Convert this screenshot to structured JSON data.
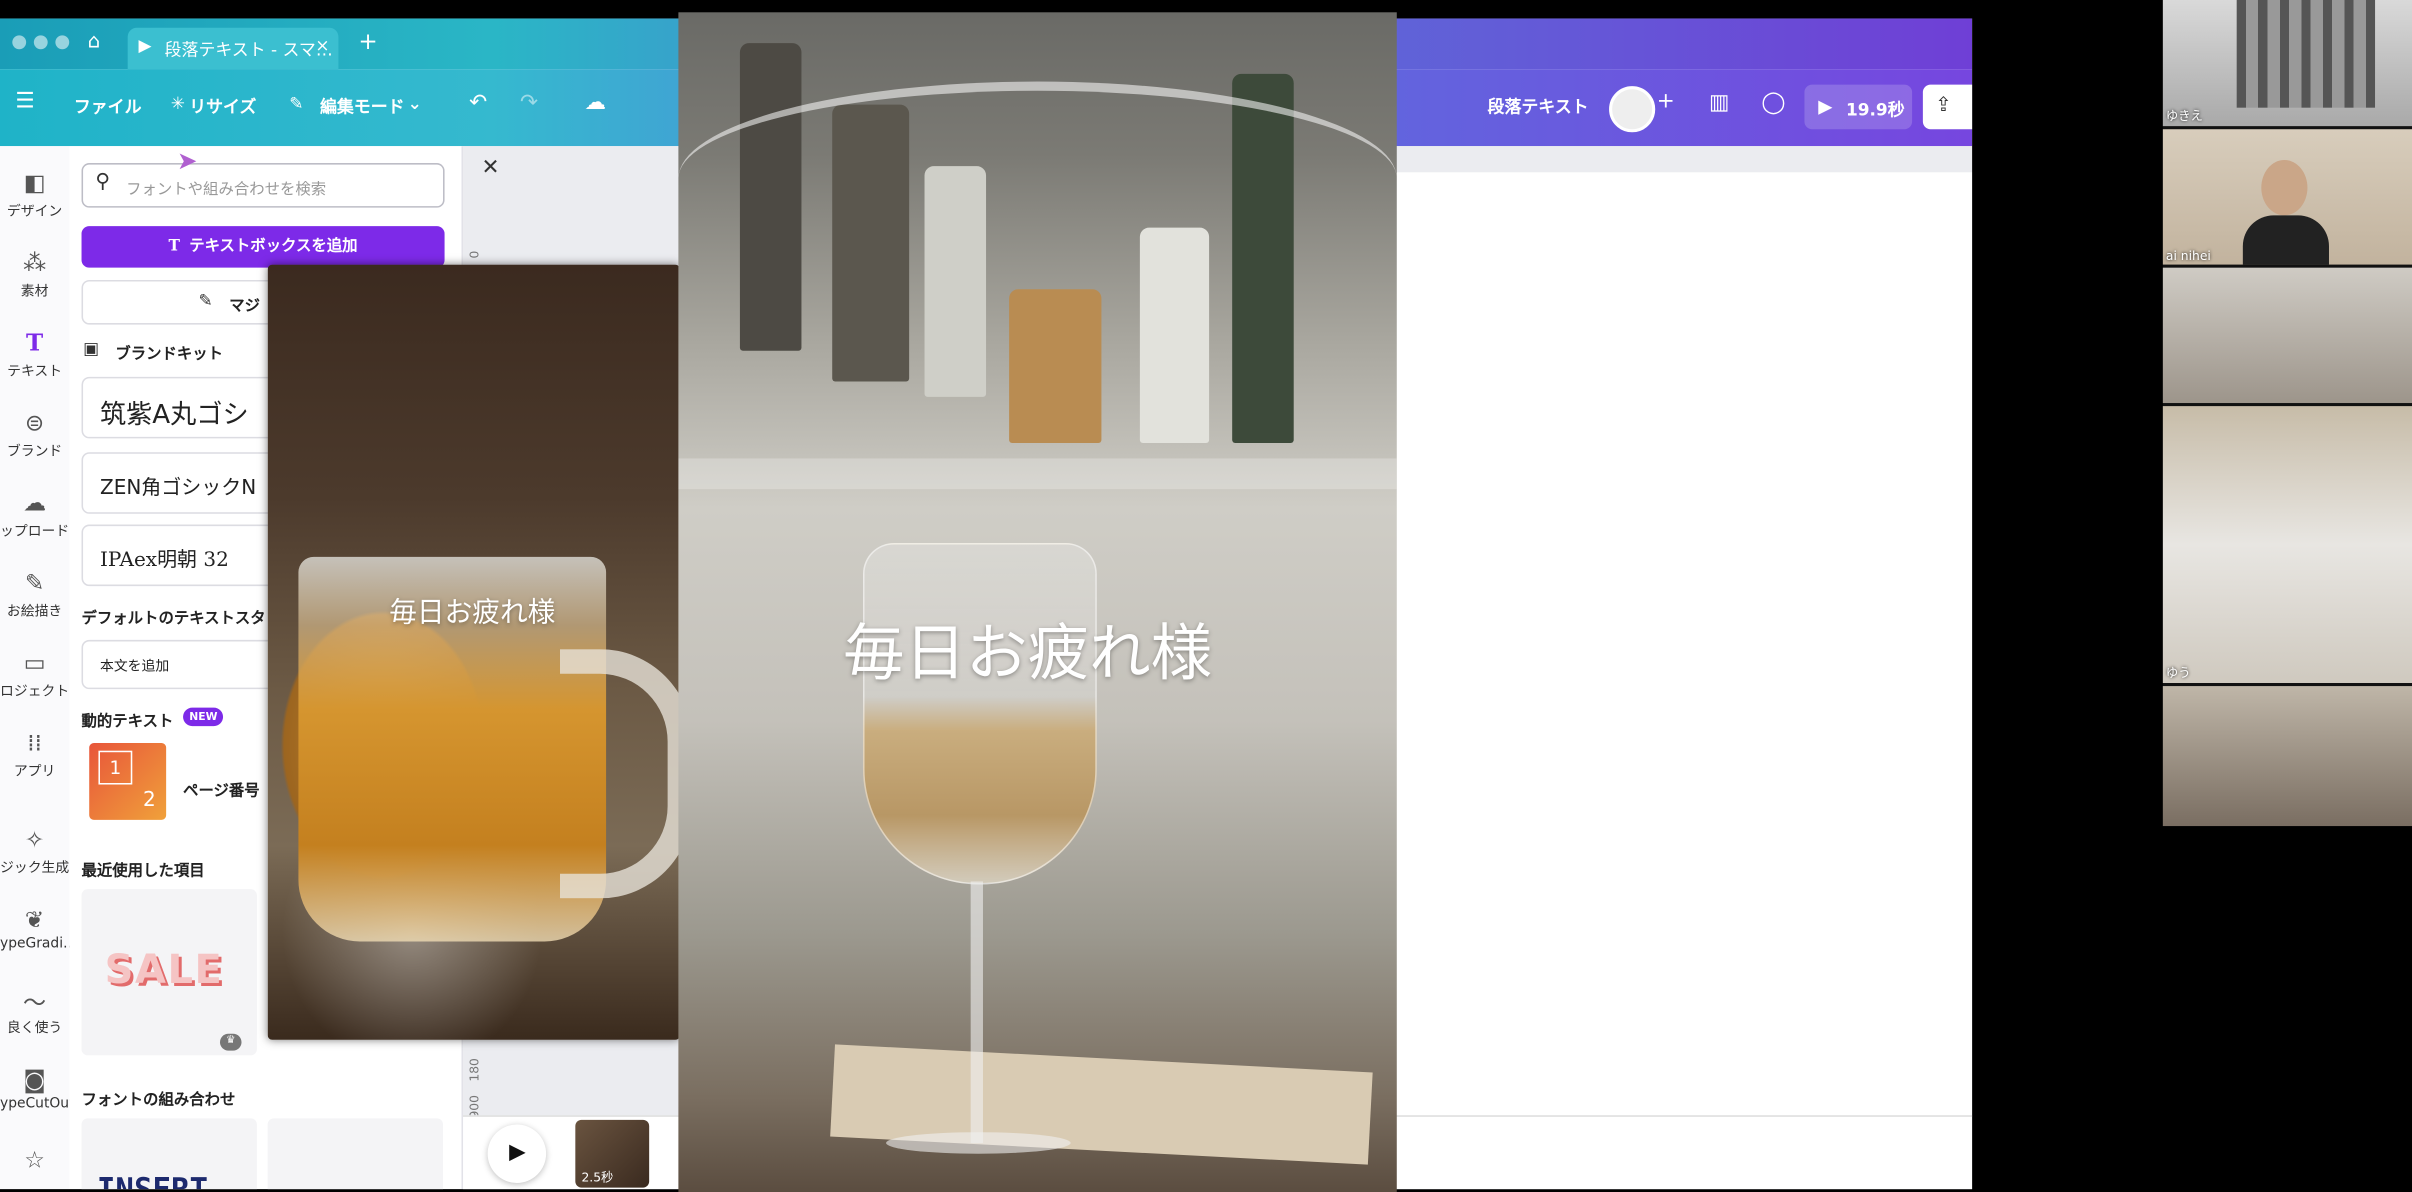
{
  "tabbar": {
    "tab_title": "段落テキスト - スマ…",
    "close_glyph": "×",
    "new_tab_glyph": "+"
  },
  "toolbar": {
    "file": "ファイル",
    "resize": "リサイズ",
    "edit_mode": "編集モード",
    "doc_title": "段落テキスト",
    "play_time": "19.9秒"
  },
  "rail": {
    "items": [
      "デザイン",
      "素材",
      "テキスト",
      "ブランド",
      "ップロード",
      "お絵描き",
      "ロジェクト",
      "アプリ",
      "ジック生成",
      "ypeGradi…",
      "良く使う",
      "ypeCutOut"
    ]
  },
  "panel": {
    "search_placeholder": "フォントや組み合わせを検索",
    "add_textbox": "テキストボックスを追加",
    "magic": "マジ",
    "brand_kit": "ブランドキット",
    "fonts": [
      "筑紫A丸ゴシ",
      "ZEN角ゴシックN",
      "IPAex明朝 32"
    ],
    "default_styles": "デフォルトのテキストスタ",
    "add_body": "本文を追加",
    "dynamic_text": "動的テキスト",
    "new_badge": "NEW",
    "page_number": "ページ番号",
    "page_thumb_1": "1",
    "page_thumb_2": "2",
    "recent": "最近使用した項目",
    "sale": "SALE",
    "font_combos": "フォントの組み合わせ",
    "insert": "INSERT"
  },
  "canvas": {
    "ruler_0": "0",
    "ruler_180": "180",
    "ruler_900": "900",
    "clip_duration": "2.5秒"
  },
  "overlay": {
    "mug_text": "毎日お疲れ様",
    "wine_text": "毎日お疲れ様"
  },
  "zoom": {
    "participants": [
      "ゆきえ",
      "ai nihei",
      "",
      "ゆう",
      ""
    ]
  },
  "colors": {
    "canva_purple": "#7d2ae8",
    "toolbar_teal": "#1fb3c8",
    "toolbar_violet": "#7646df"
  }
}
